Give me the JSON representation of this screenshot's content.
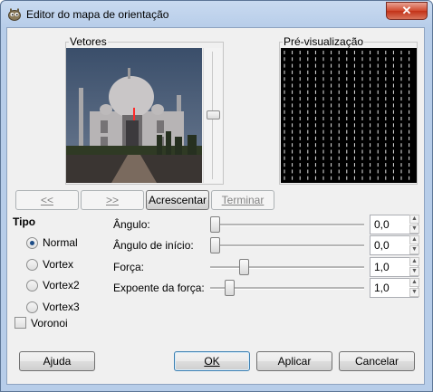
{
  "window": {
    "title": "Editor do mapa de orientação",
    "close_icon": "close-icon"
  },
  "colors": {
    "titlebar": "#b7cde9",
    "client": "#f0f0f0",
    "close_red": "#c33218",
    "flow_bg": "#000000"
  },
  "panels": {
    "vectors_label": "Vetores",
    "preview_label": "Pré-visualização"
  },
  "nav_buttons": {
    "prev": "<<",
    "next": ">>",
    "add": "Acrescentar",
    "finish": "Terminar"
  },
  "type_group": {
    "label": "Tipo",
    "options": [
      "Normal",
      "Vortex",
      "Vortex2",
      "Vortex3"
    ],
    "selected": "Normal",
    "voronoi_label": "Voronoi",
    "voronoi_checked": false
  },
  "params": [
    {
      "label": "Ângulo:",
      "value": "0,0",
      "slider_fraction": 0.0
    },
    {
      "label": "Ângulo de início:",
      "value": "0,0",
      "slider_fraction": 0.0
    },
    {
      "label": "Força:",
      "value": "1,0",
      "slider_fraction": 0.2
    },
    {
      "label": "Expoente da força:",
      "value": "1,0",
      "slider_fraction": 0.1
    }
  ],
  "footer": {
    "help": "Ajuda",
    "ok": "OK",
    "apply": "Aplicar",
    "cancel": "Cancelar"
  }
}
